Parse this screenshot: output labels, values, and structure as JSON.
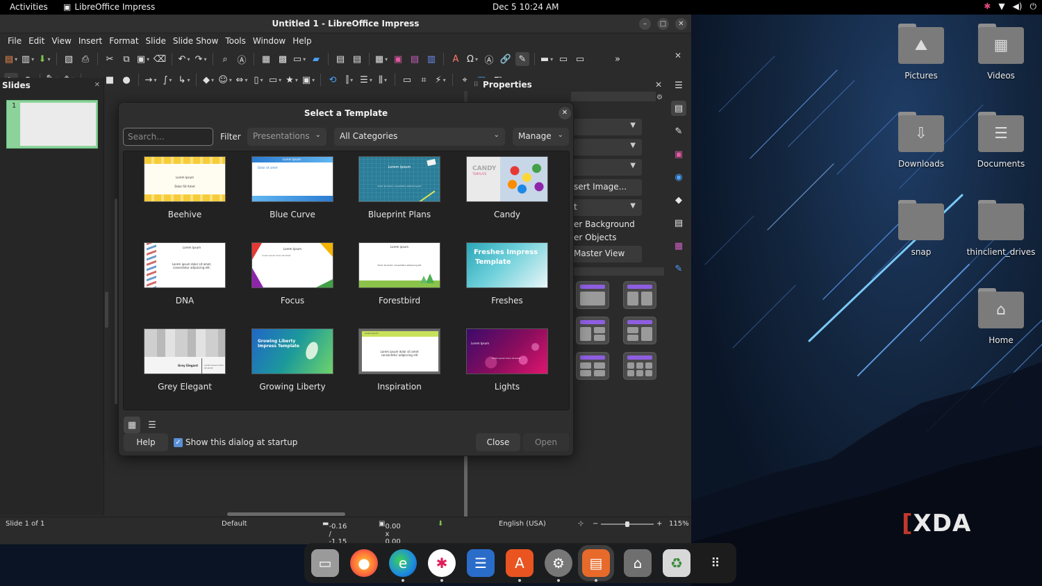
{
  "topbar": {
    "activities": "Activities",
    "app_name": "LibreOffice Impress",
    "clock": "Dec 5  10:24 AM"
  },
  "window": {
    "title": "Untitled 1 - LibreOffice Impress"
  },
  "menu": [
    "File",
    "Edit",
    "View",
    "Insert",
    "Format",
    "Slide",
    "Slide Show",
    "Tools",
    "Window",
    "Help"
  ],
  "slides_pane": {
    "title": "Slides",
    "slide_number": "1"
  },
  "properties": {
    "title": "Properties",
    "insert_image": "sert Image...",
    "dropdown5_text": "t",
    "master_background": "er Background",
    "master_objects": "er Objects",
    "master_view": "Master View"
  },
  "dialog": {
    "title": "Select a Template",
    "search_placeholder": "Search...",
    "filter_label": "Filter",
    "filter_value": "Presentations",
    "category_value": "All Categories",
    "manage_label": "Manage",
    "help_label": "Help",
    "show_startup_label": "Show this dialog at startup",
    "close_label": "Close",
    "open_label": "Open",
    "templates": [
      {
        "name": "Beehive",
        "text1": "Lorem Ipsum",
        "text2": "Dolor Sit Amet"
      },
      {
        "name": "Blue Curve",
        "text1": "Lorem Ipsum",
        "text2": "Dolor sit amet"
      },
      {
        "name": "Blueprint Plans",
        "text1": "Lorem Ipsum",
        "text2": "Dolor sit amet, consectetur adipiscing elit"
      },
      {
        "name": "Candy",
        "text1": "CANDY",
        "text2": "TEMPLATE"
      },
      {
        "name": "DNA",
        "text1": "Lorem Ipsum",
        "text2": "Lorem ipsum dolor sit amet, consectetur adipiscing elit."
      },
      {
        "name": "Focus",
        "text1": "Lorem Ipsum",
        "text2": "Lorem ipsum dolor sit amet"
      },
      {
        "name": "Forestbird",
        "text1": "Lorem ipsum",
        "text2": "Dolor sit amet, consectetur adipiscing elit"
      },
      {
        "name": "Freshes",
        "text1": "Freshes Impress",
        "text2": "Template"
      },
      {
        "name": "Grey Elegant",
        "text1": "Grey Elegant",
        "text2": "Lorem ipsum dolor sit amet"
      },
      {
        "name": "Growing Liberty",
        "text1": "Growing Liberty",
        "text2": "Impress Template"
      },
      {
        "name": "Inspiration",
        "text1": "Lorem Ipsum",
        "text2": "Lorem ipsum dolor sit amet consectetur adipiscing elit"
      },
      {
        "name": "Lights",
        "text1": "Lorem Ipsum",
        "text2": "Lorem ipsum dolor sit amet"
      }
    ]
  },
  "statusbar": {
    "slide": "Slide 1 of 1",
    "master": "Default",
    "position": "-0.16 / -1.15",
    "size": "0.00 x 0.00",
    "language": "English (USA)",
    "zoom": "115%"
  },
  "desktop": {
    "icons": [
      {
        "label": "Pictures",
        "icon": "image-icon"
      },
      {
        "label": "Videos",
        "icon": "film-icon"
      },
      {
        "label": "Downloads",
        "icon": "download-icon"
      },
      {
        "label": "Documents",
        "icon": "document-icon"
      },
      {
        "label": "snap",
        "icon": "folder-icon"
      },
      {
        "label": "thinclient_drives",
        "icon": "folder-icon"
      },
      {
        "label": "Home",
        "icon": "home-icon"
      }
    ]
  },
  "dock": [
    "Files",
    "Firefox",
    "Microsoft Edge",
    "Slack",
    "LibreOffice Writer",
    "Ubuntu Software",
    "Settings",
    "LibreOffice Impress",
    "USB Drive",
    "Trash",
    "Show Applications"
  ],
  "watermark": "XDA"
}
